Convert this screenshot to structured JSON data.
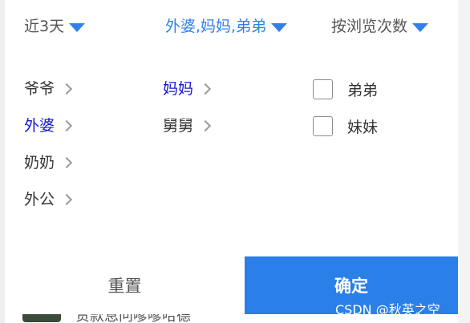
{
  "filters": {
    "date": "近3天",
    "relation": "外婆,妈妈,弟弟",
    "sort": "按浏览次数",
    "caret_icon": "caret-down-icon"
  },
  "column1": {
    "items": [
      {
        "label": "爷爷",
        "active": false
      },
      {
        "label": "外婆",
        "active": true
      },
      {
        "label": "奶奶",
        "active": false
      },
      {
        "label": "外公",
        "active": false
      }
    ]
  },
  "column2": {
    "items": [
      {
        "label": "妈妈",
        "active": true
      },
      {
        "label": "舅舅",
        "active": false
      }
    ]
  },
  "column3": {
    "items": [
      {
        "label": "弟弟",
        "checked": false
      },
      {
        "label": "妹妹",
        "checked": false
      }
    ]
  },
  "footer": {
    "reset_label": "重置",
    "confirm_label": "确定"
  },
  "underlying": {
    "text": "贷款息问嗲嗲哈德"
  },
  "watermark": "CSDN @秋英之空",
  "colors": {
    "accent": "#2f80ed",
    "confirm_bg": "#2b7fe8",
    "active_text": "#1414d2"
  }
}
